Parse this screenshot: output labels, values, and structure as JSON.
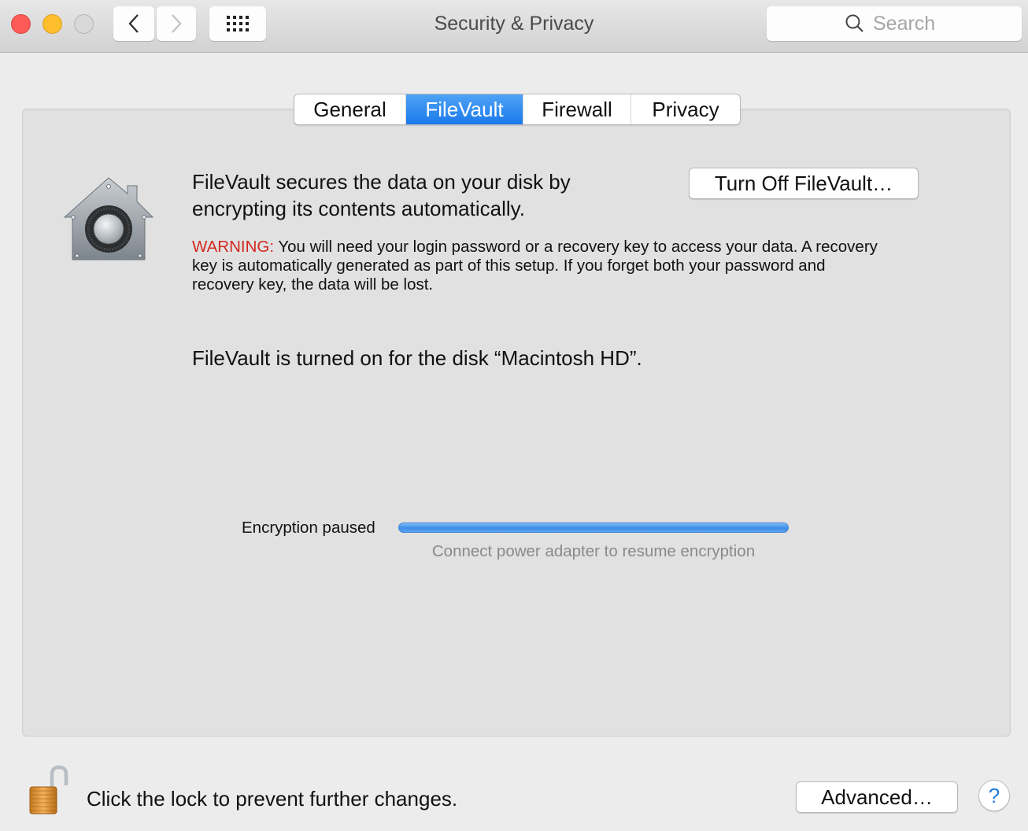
{
  "window": {
    "title": "Security & Privacy",
    "controls": [
      "close",
      "minimize",
      "zoom"
    ],
    "nav": {
      "back_icon": "chevron-left-icon",
      "forward_icon": "chevron-right-icon",
      "show_all_icon": "grid-icon"
    },
    "search": {
      "placeholder": "Search",
      "value": "",
      "icon": "search-icon"
    }
  },
  "tabs": [
    {
      "label": "General",
      "active": false
    },
    {
      "label": "FileVault",
      "active": true
    },
    {
      "label": "Firewall",
      "active": false
    },
    {
      "label": "Privacy",
      "active": false
    }
  ],
  "filevault": {
    "icon": "filevault-house-safe-icon",
    "description": "FileVault secures the data on your disk by encrypting its contents automatically.",
    "turn_off_button": "Turn Off FileVault…",
    "warning_label": "WARNING:",
    "warning_text": " You will need your login password or a recovery key to access your data. A recovery key is automatically generated as part of this setup. If you forget both your password and recovery key, the data will be lost.",
    "status": "FileVault is turned on for the disk “Macintosh HD”.",
    "encryption": {
      "label": "Encryption paused",
      "progress_percent": 100,
      "hint": "Connect power adapter to resume encryption"
    }
  },
  "footer": {
    "lock_icon": "unlocked-padlock-icon",
    "lock_text": "Click the lock to prevent further changes.",
    "advanced_button": "Advanced…",
    "help_button": "?"
  },
  "colors": {
    "accent": "#1a79ea",
    "warning": "#d2281e",
    "progress": "#3d8ee9"
  }
}
